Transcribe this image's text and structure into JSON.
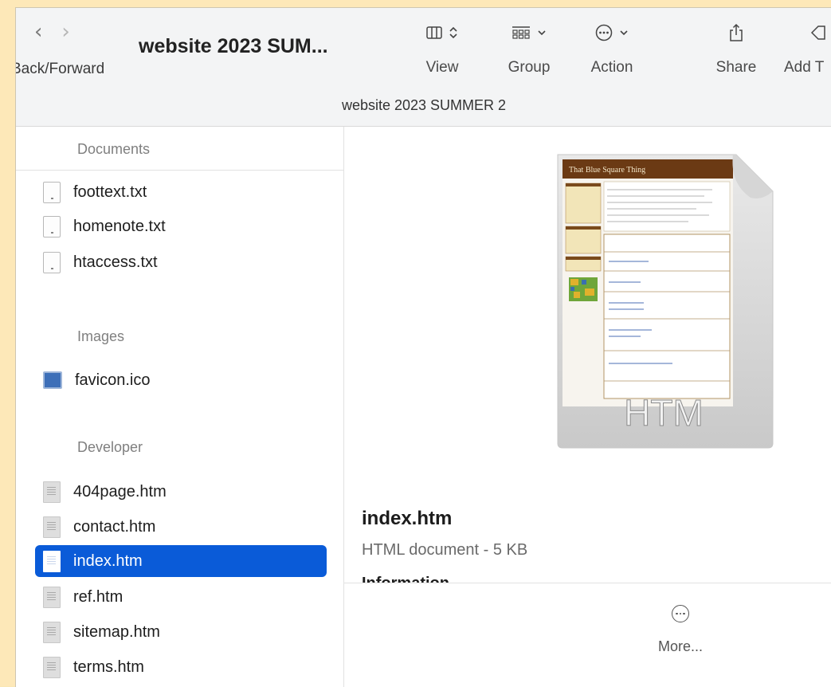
{
  "window": {
    "title": "website 2023 SUM...",
    "path_title": "website 2023 SUMMER 2"
  },
  "toolbar": {
    "back_icon": "‹",
    "forward_icon": "›",
    "nav_label": "Back/Forward",
    "view_label": "View",
    "group_label": "Group",
    "action_label": "Action",
    "share_label": "Share",
    "add_label": "Add T"
  },
  "sidebar": {
    "sections": [
      {
        "title": "Documents",
        "items": [
          {
            "label": "foottext.txt",
            "icon": "text-file-icon"
          },
          {
            "label": "homenote.txt",
            "icon": "text-file-icon"
          },
          {
            "label": "htaccess.txt",
            "icon": "text-file-icon"
          }
        ]
      },
      {
        "title": "Images",
        "items": [
          {
            "label": "favicon.ico",
            "icon": "image-file-icon"
          }
        ]
      },
      {
        "title": "Developer",
        "items": [
          {
            "label": "404page.htm",
            "icon": "html-file-icon"
          },
          {
            "label": "contact.htm",
            "icon": "html-file-icon"
          },
          {
            "label": "index.htm",
            "icon": "html-file-icon",
            "selected": true
          },
          {
            "label": "ref.htm",
            "icon": "html-file-icon"
          },
          {
            "label": "sitemap.htm",
            "icon": "html-file-icon"
          },
          {
            "label": "terms.htm",
            "icon": "html-file-icon"
          }
        ]
      }
    ]
  },
  "preview": {
    "doc_heading": "That Blue Square Thing",
    "doc_badge": "HTM",
    "name": "index.htm",
    "type": "HTML document - 5 KB",
    "info_label": "Information",
    "more_label": "More..."
  },
  "colors": {
    "selection": "#0a5bd8",
    "frame": "#fde8b8"
  }
}
